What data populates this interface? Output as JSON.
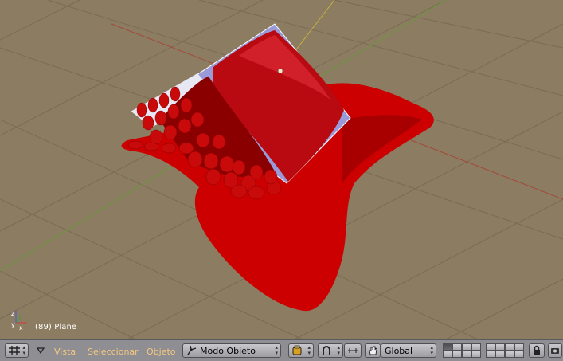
{
  "viewport": {
    "status_text": "(89) Plane",
    "axis_labels": {
      "x": "x",
      "y": "y",
      "z": "z"
    },
    "colors": {
      "background": "#8b7c62",
      "grid_line": "#7a6b52",
      "cloth_red": "#cc0000",
      "cloth_dark": "#8a0000",
      "plane_blue": "#9a9ad8",
      "x_axis": "#a34a3a",
      "y_axis": "#6a9a3a",
      "z_axis": "#c8b040"
    }
  },
  "toolbar": {
    "window_type_icon": "grid-icon",
    "menu_toggle_icon": "triangle-down-icon",
    "menu_vista": "Vista",
    "menu_seleccionar": "Seleccionar",
    "menu_objeto": "Objeto",
    "mode_label": "Modo Objeto",
    "mode_icon": "object-mode-icon",
    "draw_type_icon": "shading-icon",
    "pivot_icon": "pivot-icon",
    "manipulator_icon": "hand-icon",
    "orientation_label": "Global",
    "layers_icon": "layers-icon",
    "lock_icon": "lock-icon",
    "colors": {
      "bar": "#8e8e93",
      "menu_text": "#f6c97f"
    }
  }
}
